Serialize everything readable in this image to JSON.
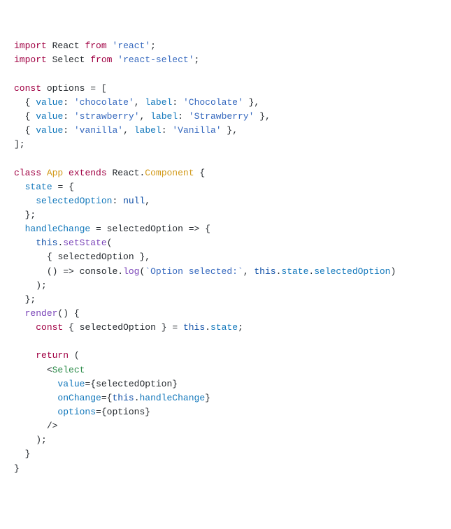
{
  "code": {
    "lines": [
      "import React from 'react';",
      "import Select from 'react-select';",
      "",
      "const options = [",
      "  { value: 'chocolate', label: 'Chocolate' },",
      "  { value: 'strawberry', label: 'Strawberry' },",
      "  { value: 'vanilla', label: 'Vanilla' },",
      "];",
      "",
      "class App extends React.Component {",
      "  state = {",
      "    selectedOption: null,",
      "  };",
      "  handleChange = selectedOption => {",
      "    this.setState(",
      "      { selectedOption },",
      "      () => console.log(`Option selected:`, this.state.selectedOption)",
      "    );",
      "  };",
      "  render() {",
      "    const { selectedOption } = this.state;",
      "",
      "    return (",
      "      <Select",
      "        value={selectedOption}",
      "        onChange={this.handleChange}",
      "        options={options}",
      "      />",
      "    );",
      "  }",
      "}"
    ]
  },
  "tokens": {
    "import": "import",
    "from": "from",
    "React": "React",
    "Select": "Select",
    "reactStr": "'react'",
    "reactSelectStr": "'react-select'",
    "const": "const",
    "options": "options",
    "value": "value",
    "label": "label",
    "chocolateV": "'chocolate'",
    "chocolateL": "'Chocolate'",
    "strawberryV": "'strawberry'",
    "strawberryL": "'Strawberry'",
    "vanillaV": "'vanilla'",
    "vanillaL": "'Vanilla'",
    "class": "class",
    "App": "App",
    "extends": "extends",
    "Component": "Component",
    "state": "state",
    "selectedOption": "selectedOption",
    "null": "null",
    "handleChange": "handleChange",
    "this": "this",
    "setState": "setState",
    "console": "console",
    "log": "log",
    "tpl": "`Option selected:`",
    "render": "render",
    "return": "return",
    "onChange": "onChange",
    "valueAttr": "value",
    "optionsAttr": "options"
  }
}
